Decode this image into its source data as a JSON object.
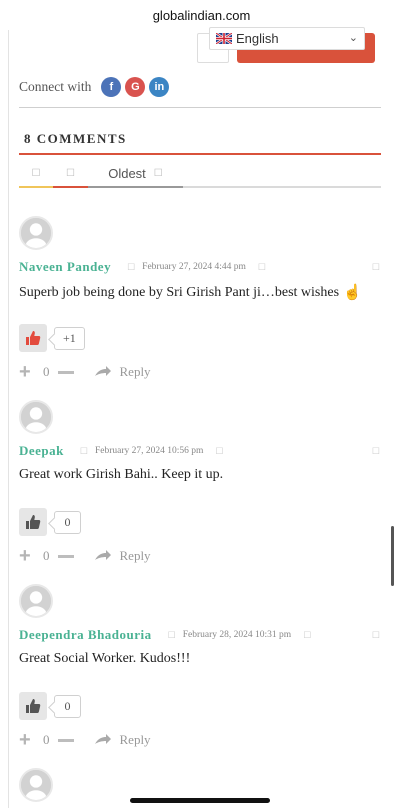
{
  "browser": {
    "url": "globalindian.com"
  },
  "language": {
    "selected": "English",
    "flag": "uk-flag"
  },
  "share": {
    "label": "Connect with",
    "networks": [
      {
        "name": "facebook",
        "glyph": "f",
        "color": "#4c73b8"
      },
      {
        "name": "google",
        "glyph": "G",
        "color": "#d9534f"
      },
      {
        "name": "linkedin",
        "glyph": "in",
        "color": "#3b85c4"
      }
    ]
  },
  "comments_section": {
    "title": "8 COMMENTS",
    "tabs": [
      {
        "label": "",
        "icon": "square-glyph"
      },
      {
        "label": "",
        "icon": "square-glyph"
      },
      {
        "label": "Oldest",
        "icon": "square-glyph"
      }
    ]
  },
  "comments": [
    {
      "author": "Naveen Pandey",
      "date": "February 27, 2024 4:44 pm",
      "text": "Superb job being done by Sri Girish Pant ji…best wishes",
      "emoji": "☝",
      "likes": "+1",
      "liked": true,
      "votes": "0",
      "reply_label": "Reply"
    },
    {
      "author": "Deepak",
      "date": "February 27, 2024 10:56 pm",
      "text": "Great work Girish Bahi.. Keep it up.",
      "likes": "0",
      "liked": false,
      "votes": "0",
      "reply_label": "Reply"
    },
    {
      "author": "Deependra Bhadouria",
      "date": "February 28, 2024 10:31 pm",
      "text": "Great Social Worker. Kudos!!!",
      "likes": "0",
      "liked": false,
      "votes": "0",
      "reply_label": "Reply"
    }
  ],
  "colors": {
    "accent_red": "#d9523b",
    "author_green": "#4ab293",
    "tab_yellow": "#f0c55a"
  }
}
